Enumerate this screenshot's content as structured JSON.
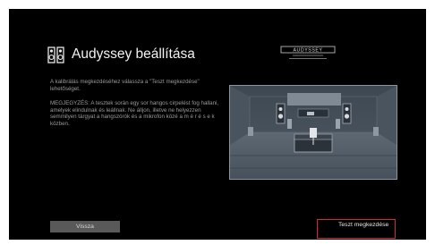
{
  "header": {
    "title": "Audyssey beállítása",
    "title_icon": "audyssey-setup-icon",
    "brand_logo_text": "AUDYSSEY"
  },
  "instructions": {
    "line1": "A kalibrálás megkezdéséhez válassza a \"Teszt megkezdése\" lehetőséget.",
    "note": "MEGJEGYZÉS: A tesztek során egy sor hangos cirpelést fog hallani, amelyek elindulnak és leállnak. Ne álljon, illetve ne helyezzen semmilyen tárgyat a hangszórók és a mikrofon közé a m é r é s e k közben."
  },
  "illustration": {
    "name": "listening-room-with-speakers"
  },
  "buttons": {
    "back_label": "Vissza",
    "start_label": "Teszt megkezdése"
  },
  "colors": {
    "background": "#000000",
    "focus_border": "#d9272e",
    "back_button": "#595959"
  }
}
